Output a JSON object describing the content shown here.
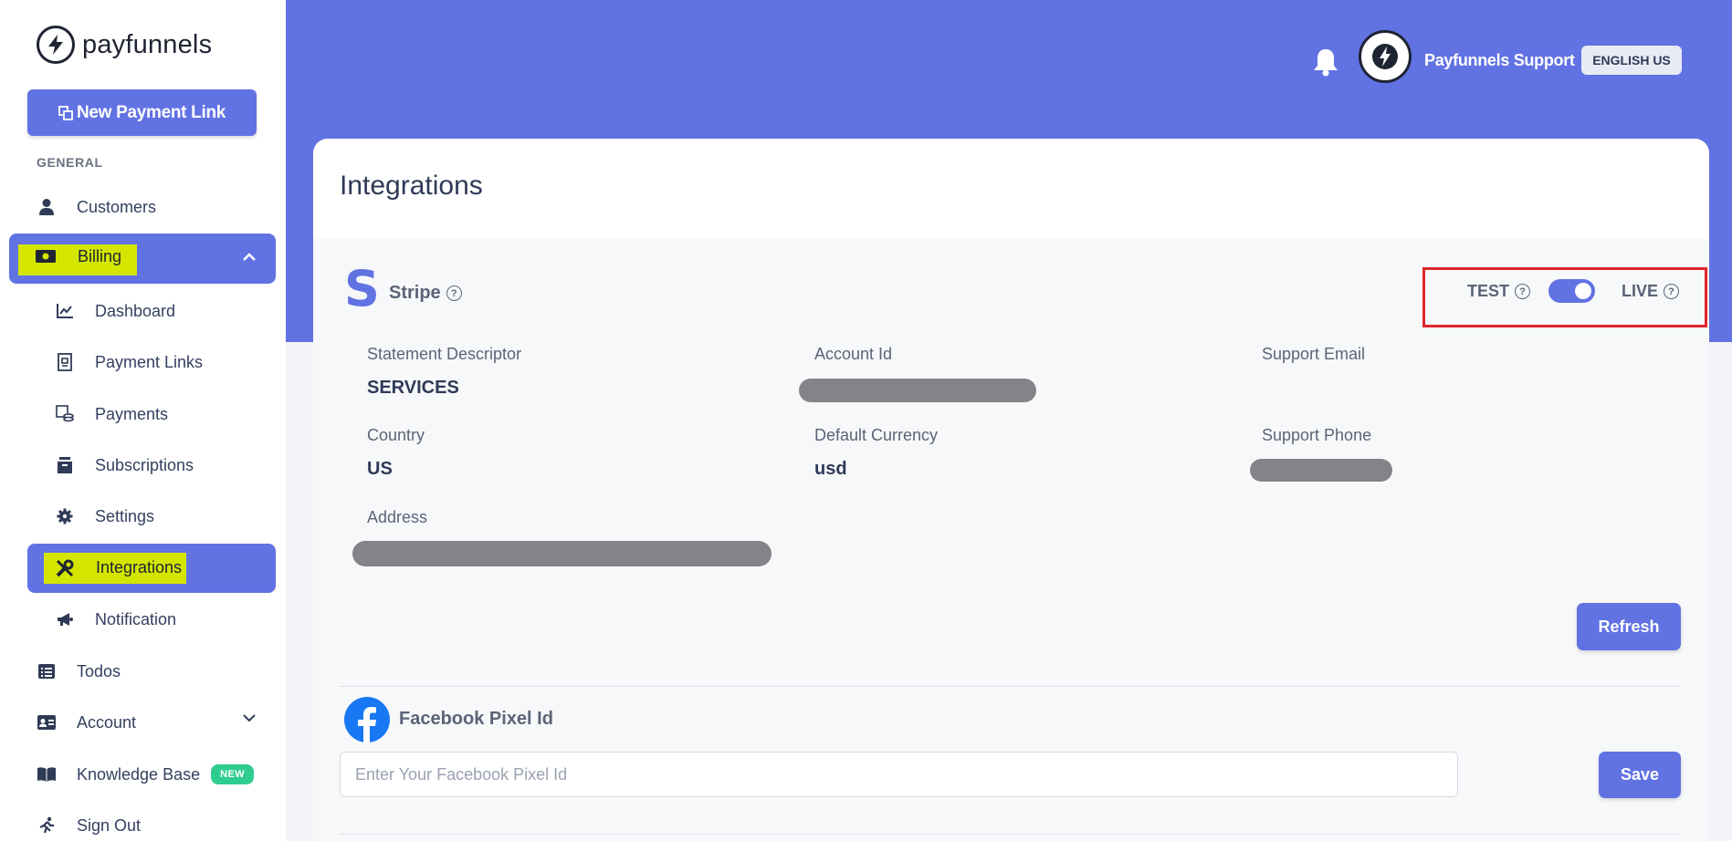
{
  "sidebar": {
    "logo_text": "payfunnels",
    "new_payment_link": "New Payment Link",
    "section_general": "GENERAL",
    "customers": "Customers",
    "billing": "Billing",
    "billing_children": {
      "dashboard": "Dashboard",
      "payment_links": "Payment Links",
      "payments": "Payments",
      "subscriptions": "Subscriptions",
      "settings": "Settings",
      "integrations": "Integrations",
      "notification": "Notification"
    },
    "todos": "Todos",
    "account": "Account",
    "knowledge_base": "Knowledge Base",
    "knowledge_base_badge": "NEW",
    "sign_out": "Sign Out"
  },
  "header": {
    "user_name": "Payfunnels Support",
    "language": "ENGLISH US"
  },
  "page": {
    "title": "Integrations"
  },
  "stripe": {
    "logo_letter": "S",
    "name": "Stripe",
    "mode_test": "TEST",
    "mode_live": "LIVE",
    "fields": {
      "statement_descriptor_label": "Statement Descriptor",
      "statement_descriptor_value": "SERVICES",
      "account_id_label": "Account Id",
      "support_email_label": "Support Email",
      "country_label": "Country",
      "country_value": "US",
      "default_currency_label": "Default Currency",
      "default_currency_value": "usd",
      "support_phone_label": "Support Phone",
      "address_label": "Address"
    },
    "refresh": "Refresh"
  },
  "facebook": {
    "label": "Facebook Pixel Id",
    "placeholder": "Enter Your Facebook Pixel Id",
    "value": "",
    "save": "Save"
  },
  "colors": {
    "primary": "#6172e3",
    "highlight": "#d4e600",
    "annotation_red": "#e0242c",
    "badge_green": "#2ecc8f"
  }
}
